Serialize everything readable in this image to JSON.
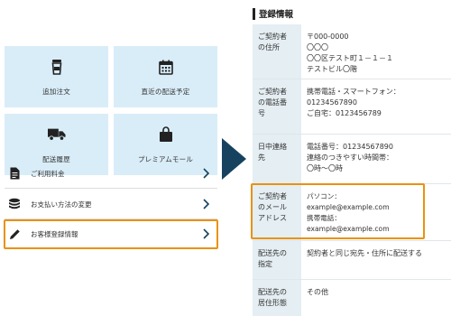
{
  "menu": {
    "tiles": [
      {
        "label": "追加注文",
        "icon": "cup-icon"
      },
      {
        "label": "直近の配送予定",
        "icon": "calendar-icon"
      },
      {
        "label": "配送履歴",
        "icon": "truck-icon"
      },
      {
        "label": "プレミアムモール",
        "icon": "shopping-bag-icon"
      }
    ],
    "list": [
      {
        "label": "ご利用料金",
        "icon": "document-icon"
      },
      {
        "label": "お支払い方法の変更",
        "icon": "coins-icon"
      },
      {
        "label": "お客様登録情報",
        "icon": "pencil-icon"
      }
    ]
  },
  "registration": {
    "title": "登録情報",
    "rows": [
      {
        "key": "ご契約者\nの住所",
        "value": "〒000-0000\n〇〇〇\n〇〇区テスト町１－１－１\nテストビル〇階"
      },
      {
        "key": "ご契約者\nの電話番\n号",
        "value": "携帯電話・スマートフォン：\n01234567890\nご自宅：0123456789"
      },
      {
        "key": "日中連絡\n先",
        "value": "電話番号：01234567890\n連絡のつきやすい時間帯：\n〇時～〇時"
      },
      {
        "key": "ご契約者\nのメール\nアドレス",
        "value": "パソコン：\nexample@example.com\n携帯電話：\nexample@example.com"
      },
      {
        "key": "配送先の\n指定",
        "value": "契約者と同じ宛先・住所に配送する"
      },
      {
        "key": "配送先の\n居住形態",
        "value": "その他"
      }
    ]
  },
  "colors": {
    "tile_bg": "#d9edf8",
    "highlight": "#e8920f",
    "arrow": "#16425f",
    "key_bg": "#e4eef3"
  }
}
